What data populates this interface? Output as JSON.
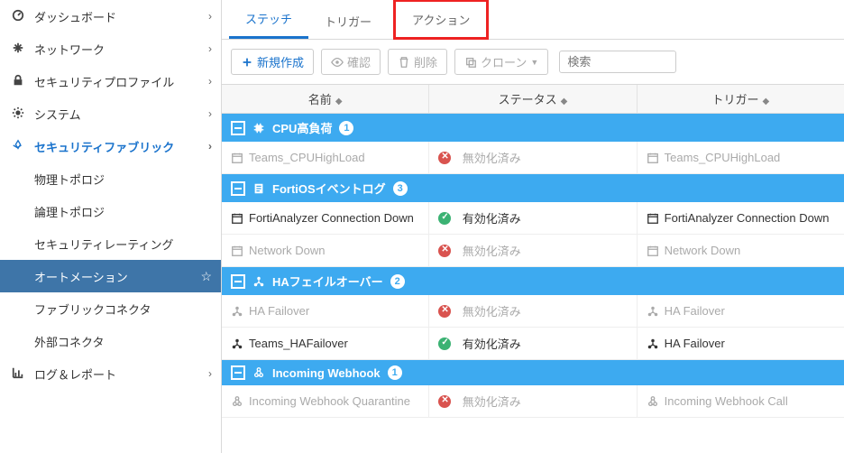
{
  "sidebar": {
    "items": [
      {
        "icon": "dashboard-icon",
        "label": "ダッシュボード",
        "chevron": true
      },
      {
        "icon": "network-icon",
        "label": "ネットワーク",
        "chevron": true
      },
      {
        "icon": "lock-icon",
        "label": "セキュリティプロファイル",
        "chevron": true
      },
      {
        "icon": "gear-icon",
        "label": "システム",
        "chevron": true
      },
      {
        "icon": "fabric-icon",
        "label": "セキュリティファブリック",
        "chevron": true,
        "active": true
      }
    ],
    "subitems": [
      {
        "label": "物理トポロジ"
      },
      {
        "label": "論理トポロジ"
      },
      {
        "label": "セキュリティレーティング"
      },
      {
        "label": "オートメーション",
        "selected": true
      },
      {
        "label": "ファブリックコネクタ"
      },
      {
        "label": "外部コネクタ"
      }
    ],
    "footer": {
      "icon": "chart-icon",
      "label": "ログ＆レポート",
      "chevron": true
    }
  },
  "tabs": {
    "stitch": "ステッチ",
    "trigger": "トリガー",
    "action": "アクション"
  },
  "toolbar": {
    "create": "新規作成",
    "edit": "確認",
    "delete": "削除",
    "clone": "クローン",
    "search_placeholder": "検索"
  },
  "columns": {
    "name": "名前",
    "status": "ステータス",
    "trigger": "トリガー"
  },
  "status_labels": {
    "enabled": "有効化済み",
    "disabled": "無効化済み"
  },
  "groups": [
    {
      "icon": "cpu-icon",
      "title": "CPU高負荷",
      "count": "1",
      "rows": [
        {
          "name": "Teams_CPUHighLoad",
          "status": "disabled",
          "trigger": "Teams_CPUHighLoad",
          "dim": true,
          "row_icon": "calendar-icon"
        }
      ]
    },
    {
      "icon": "log-icon",
      "title": "FortiOSイベントログ",
      "count": "3",
      "rows": [
        {
          "name": "FortiAnalyzer Connection Down",
          "status": "enabled",
          "trigger": "FortiAnalyzer Connection Down",
          "row_icon": "calendar-icon"
        },
        {
          "name": "Network Down",
          "status": "disabled",
          "trigger": "Network Down",
          "dim": true,
          "row_icon": "calendar-icon"
        }
      ]
    },
    {
      "icon": "ha-icon",
      "title": "HAフェイルオーバー",
      "count": "2",
      "rows": [
        {
          "name": "HA Failover",
          "status": "disabled",
          "trigger": "HA Failover",
          "dim": true,
          "row_icon": "ha-icon"
        },
        {
          "name": "Teams_HAFailover",
          "status": "enabled",
          "trigger": "HA Failover",
          "row_icon": "ha-icon"
        }
      ]
    },
    {
      "icon": "webhook-icon",
      "title": "Incoming Webhook",
      "count": "1",
      "rows": [
        {
          "name": "Incoming Webhook Quarantine",
          "status": "disabled",
          "trigger": "Incoming Webhook Call",
          "dim": true,
          "row_icon": "webhook-icon"
        }
      ]
    }
  ]
}
